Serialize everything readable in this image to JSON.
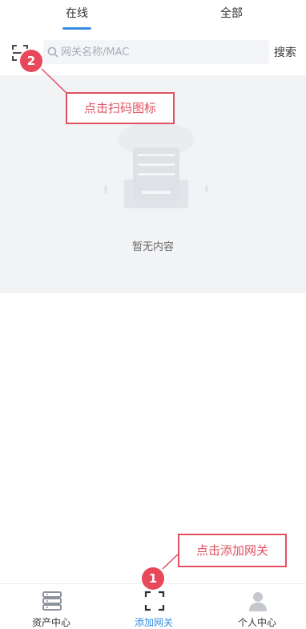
{
  "tabs": [
    {
      "label": "在线",
      "active": true
    },
    {
      "label": "全部",
      "active": false
    }
  ],
  "search": {
    "placeholder": "网关名称/MAC",
    "button_label": "搜索"
  },
  "empty_state": {
    "text": "暂无内容"
  },
  "annotations": {
    "scan_callout": "点击扫码图标",
    "scan_step": "2",
    "add_callout": "点击添加网关",
    "add_step": "1"
  },
  "bottom_nav": [
    {
      "label": "资产中心",
      "icon": "server-icon",
      "active": false
    },
    {
      "label": "添加网关",
      "icon": "scan-frame-icon",
      "active": true
    },
    {
      "label": "个人中心",
      "icon": "person-icon",
      "active": false
    }
  ],
  "colors": {
    "accent": "#3a8de0",
    "annotation": "#e0515f",
    "empty_bg": "#f2f3f5"
  }
}
